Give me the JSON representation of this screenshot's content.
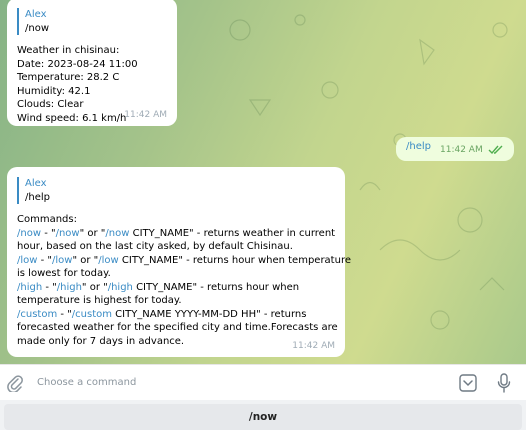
{
  "messages": [
    {
      "author": "Alex",
      "command": "/now",
      "lines": [
        "Weather in chisinau:",
        "Date: 2023-08-24 11:00",
        "Temperature: 28.2 C",
        "Humidity: 42.1",
        "Clouds: Clear",
        "Wind speed: 6.1 km/h"
      ],
      "time": "11:42 AM"
    },
    {
      "text": "/help",
      "time": "11:42 AM"
    },
    {
      "author": "Alex",
      "command": "/help",
      "heading": "Commands:",
      "items": [
        {
          "cmd": "/now",
          "sep1": " - \"",
          "cmd_q": "/now",
          "sep2": "\" or \"",
          "cmd_arg": "/now",
          "rest": " CITY_NAME\" - returns weather in current",
          "line2": "hour, based on the last city asked, by default Chisinau."
        },
        {
          "cmd": "/low",
          "sep1": " - \"",
          "cmd_q": "/low",
          "sep2": "\" or \"",
          "cmd_arg": "/low",
          "rest": " CITY_NAME\" -  returns hour when temperature",
          "line2": "is lowest for today."
        },
        {
          "cmd": " /high",
          "sep1": " - \"",
          "cmd_q": "/high",
          "sep2": "\" or \"",
          "cmd_arg": "/high",
          "rest": " CITY_NAME\" - returns hour when",
          "line2": "temperature is highest for today."
        },
        {
          "cmd": "/custom",
          "sep1": " - \"",
          "cmd_q": "/custom",
          "sep2": "",
          "cmd_arg": "",
          "rest": " CITY_NAME YYYY-MM-DD HH\" - returns",
          "line2": "forecasted weather for the specified city and time.Forecasts are",
          "line3": "made only for 7 days in advance."
        }
      ],
      "time": "11:42 AM"
    }
  ],
  "input": {
    "placeholder": "Choose a command"
  },
  "keyboard": {
    "button": "/now"
  },
  "colors": {
    "link": "#3a8bc4",
    "outgoing_bubble": "#effdde",
    "read_check": "#4fae4e"
  }
}
